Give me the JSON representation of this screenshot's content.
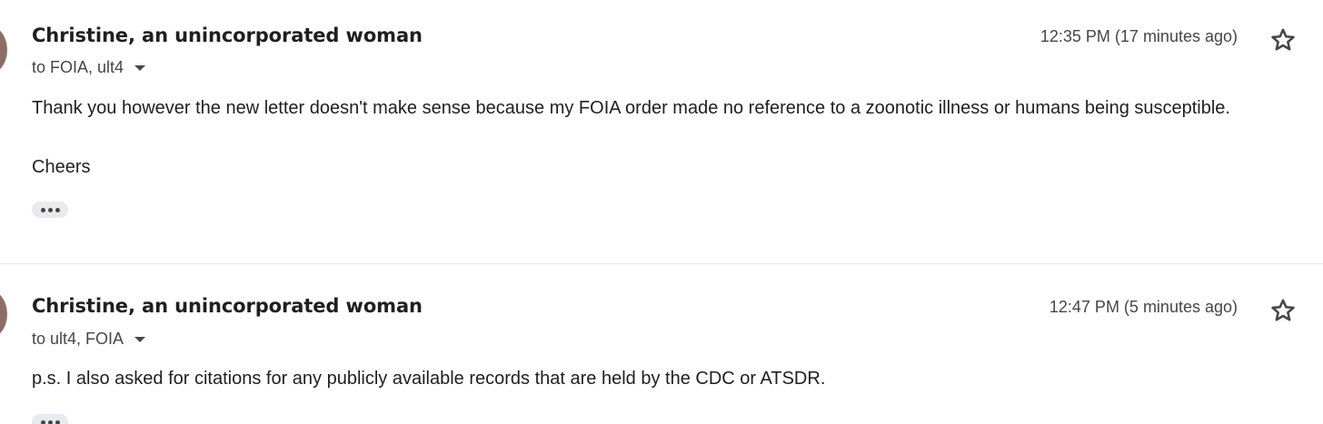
{
  "messages": [
    {
      "sender": "Christine, an unincorporated woman",
      "recipients": "to FOIA, ult4",
      "time": "12:35 PM (17 minutes ago)",
      "paragraphs": [
        "Thank you however the new letter doesn't make sense because my FOIA order made no reference to a zoonotic illness or humans being susceptible.",
        "Cheers"
      ],
      "show_trimmed_icon": "more-horiz-icon",
      "star_icon": "star-outline-icon",
      "avatar_color": "#8b6e66"
    },
    {
      "sender": "Christine, an unincorporated woman",
      "recipients": "to ult4, FOIA",
      "time": "12:47 PM (5 minutes ago)",
      "paragraphs": [
        "p.s. I also asked for citations for any publicly available records that are held by the CDC or ATSDR."
      ],
      "show_trimmed_icon": "more-horiz-icon",
      "star_icon": "star-outline-icon",
      "avatar_color": "#8b6e66"
    }
  ]
}
